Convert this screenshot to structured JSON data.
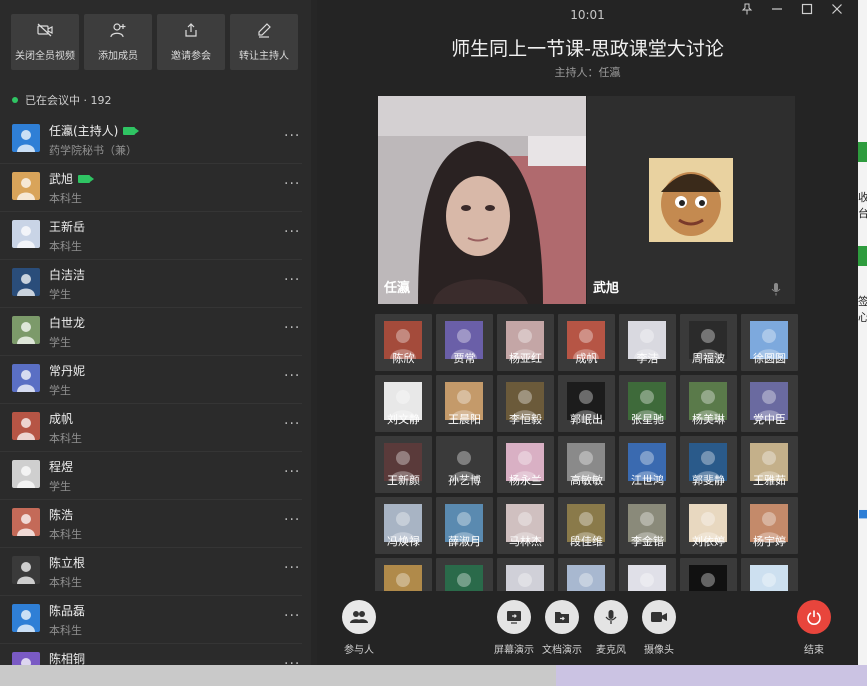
{
  "window": {
    "clock": "10:01",
    "title": "师生同上一节课-思政课堂大讨论",
    "host_line": "主持人：任瀛"
  },
  "actions": [
    {
      "label": "关闭全员视频",
      "icon": "video-off-icon"
    },
    {
      "label": "添加成员",
      "icon": "add-user-icon"
    },
    {
      "label": "邀请参会",
      "icon": "share-icon"
    },
    {
      "label": "转让主持人",
      "icon": "transfer-host-icon"
    }
  ],
  "participants": {
    "count_label": "已在会议中 · 192",
    "items": [
      {
        "name": "任瀛(主持人)",
        "role": "药学院秘书（兼）",
        "cam": true,
        "avatar": "#2f7fd6"
      },
      {
        "name": "武旭",
        "role": "本科生",
        "cam": true,
        "avatar": "#d9a45a"
      },
      {
        "name": "王新岳",
        "role": "本科生",
        "cam": false,
        "avatar": "#c9d4e6"
      },
      {
        "name": "白洁洁",
        "role": "学生",
        "cam": false,
        "avatar": "#2a4d7a"
      },
      {
        "name": "白世龙",
        "role": "学生",
        "cam": false,
        "avatar": "#7c9a6a"
      },
      {
        "name": "常丹妮",
        "role": "学生",
        "cam": false,
        "avatar": "#5a6fc4"
      },
      {
        "name": "成帆",
        "role": "本科生",
        "cam": false,
        "avatar": "#b65545"
      },
      {
        "name": "程煜",
        "role": "学生",
        "cam": false,
        "avatar": "#cfcfcf"
      },
      {
        "name": "陈浩",
        "role": "本科生",
        "cam": false,
        "avatar": "#c46a58"
      },
      {
        "name": "陈立根",
        "role": "本科生",
        "cam": false,
        "avatar": "#3a3a3a"
      },
      {
        "name": "陈品磊",
        "role": "本科生",
        "cam": false,
        "avatar": "#2f7fd6"
      },
      {
        "name": "陈相铜",
        "role": "",
        "cam": false,
        "avatar": "#7a5ac4"
      }
    ]
  },
  "videos": [
    {
      "name": "任瀛"
    },
    {
      "name": "武旭"
    }
  ],
  "grid": [
    {
      "name": "陈欣",
      "color": "#a44b3b"
    },
    {
      "name": "贾常",
      "color": "#6a5fa8"
    },
    {
      "name": "杨亚红",
      "color": "#c4a6a6"
    },
    {
      "name": "成帆",
      "color": "#b65545"
    },
    {
      "name": "李洁",
      "color": "#d9d9e0"
    },
    {
      "name": "周福波",
      "color": "#2b2b2b"
    },
    {
      "name": "徐圆圆",
      "color": "#7da9dd"
    },
    {
      "name": "刘文静",
      "color": "#e8e8e8"
    },
    {
      "name": "王晨阳",
      "color": "#c49a6a"
    },
    {
      "name": "李恒毅",
      "color": "#6b5a3a"
    },
    {
      "name": "郭岷出",
      "color": "#1c1c1c"
    },
    {
      "name": "张星驰",
      "color": "#3e6a3a"
    },
    {
      "name": "杨美琳",
      "color": "#5a7a4a"
    },
    {
      "name": "党中臣",
      "color": "#6a6aa0"
    },
    {
      "name": "王新颜",
      "color": "#5a3a3a"
    },
    {
      "name": "孙艺博",
      "color": "#3a3a3a"
    },
    {
      "name": "杨永兰",
      "color": "#d9b0c4"
    },
    {
      "name": "高敏敏",
      "color": "#8a8a8a"
    },
    {
      "name": "江世鸿",
      "color": "#3a6ab0"
    },
    {
      "name": "郭斐静",
      "color": "#2a5a8a"
    },
    {
      "name": "王雅茹",
      "color": "#c4b08a"
    },
    {
      "name": "冯焕禄",
      "color": "#a8b4c4"
    },
    {
      "name": "薛淑月",
      "color": "#5a8ab0"
    },
    {
      "name": "马林杰",
      "color": "#d0c0c0"
    },
    {
      "name": "段佳维",
      "color": "#8a7a4a"
    },
    {
      "name": "李金锴",
      "color": "#8a8a7a"
    },
    {
      "name": "刘依婷",
      "color": "#e8d8c0"
    },
    {
      "name": "杨宇婷",
      "color": "#c48a6a"
    },
    {
      "name": "",
      "color": "#b08a4a"
    },
    {
      "name": "",
      "color": "#2a6a4a"
    },
    {
      "name": "",
      "color": "#d0d0d8"
    },
    {
      "name": "",
      "color": "#a8b8d0"
    },
    {
      "name": "",
      "color": "#e0e0e8"
    },
    {
      "name": "",
      "color": "#111111"
    },
    {
      "name": "",
      "color": "#cde0f0"
    }
  ],
  "toolbar": {
    "participants": "参与人",
    "screen_share": "屏幕演示",
    "doc_share": "文档演示",
    "mic": "麦克风",
    "camera": "摄像头",
    "end": "结束"
  },
  "colors": {
    "accent_green": "#2fc463",
    "end_red": "#e8453c",
    "panel": "#2b2b2b",
    "stage": "#242424"
  }
}
